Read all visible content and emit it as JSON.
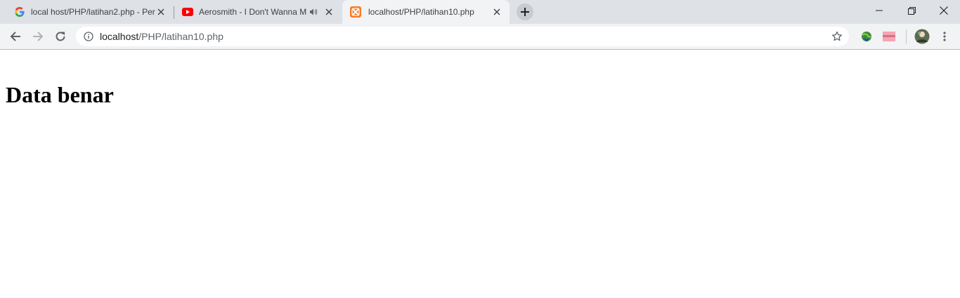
{
  "tabs": [
    {
      "title": "local host/PHP/latihan2.php - Per",
      "favicon": "google-icon",
      "active": false
    },
    {
      "title": "Aerosmith - I Don't Wanna M",
      "favicon": "youtube-icon",
      "active": false,
      "audio": true
    },
    {
      "title": "localhost/PHP/latihan10.php",
      "favicon": "xampp-icon",
      "active": true
    }
  ],
  "address_bar": {
    "host": "localhost",
    "path": "/PHP/latihan10.php"
  },
  "page": {
    "heading": "Data benar"
  },
  "colors": {
    "tabstrip": "#dee1e6",
    "toolbar": "#f1f3f4",
    "youtube": "#ff0000",
    "xampp": "#fb7a24"
  }
}
